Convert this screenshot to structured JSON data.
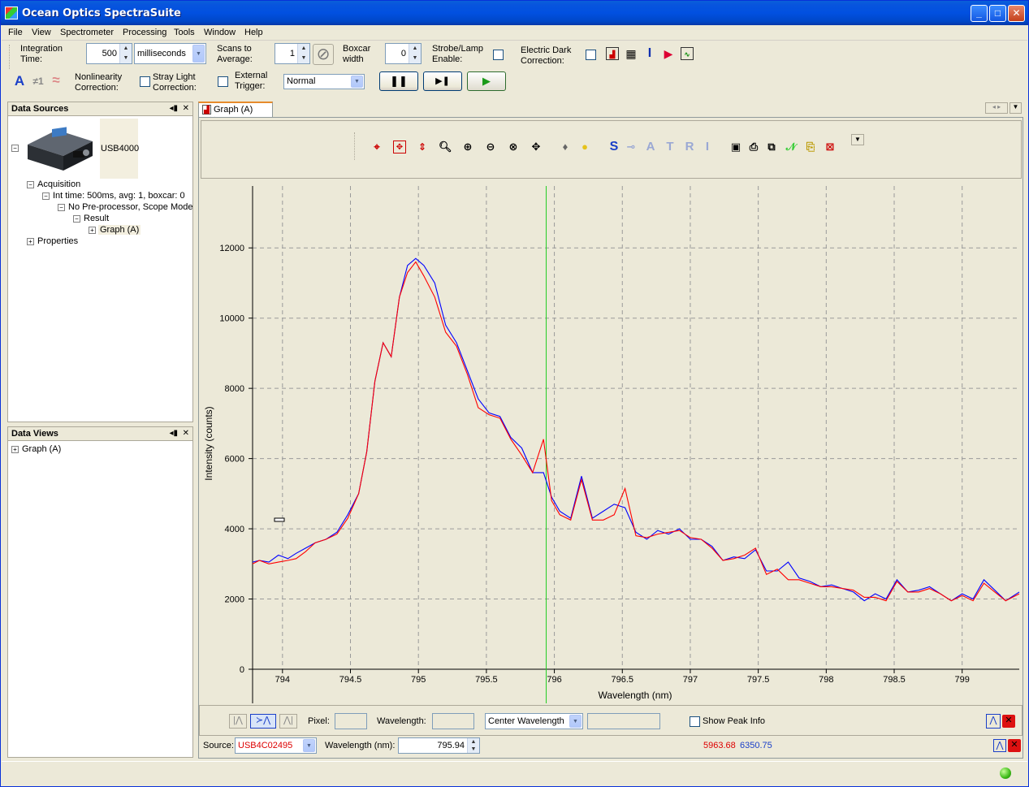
{
  "window": {
    "title": "Ocean Optics SpectraSuite",
    "minimize": "_",
    "maximize": "□",
    "close": "✕"
  },
  "menu": [
    "File",
    "View",
    "Spectrometer",
    "Processing",
    "Tools",
    "Window",
    "Help"
  ],
  "acq": {
    "integration_label": "Integration\nTime:",
    "integration_value": "500",
    "integration_unit": "milliseconds",
    "scans_label": "Scans to\nAverage:",
    "scans_value": "1",
    "boxcar_label": "Boxcar\nwidth",
    "boxcar_value": "0",
    "strobe_label": "Strobe/Lamp\nEnable:",
    "dark_label": "Electric Dark\nCorrection:",
    "nonlinearity_label": "Nonlinearity\nCorrection:",
    "stray_label": "Stray Light\nCorrection:",
    "trigger_label": "External\nTrigger:",
    "trigger_value": "Normal"
  },
  "data_sources": {
    "title": "Data Sources",
    "device": "USB4000",
    "acquisition": "Acquisition",
    "int_time": "Int time: 500ms, avg: 1, boxcar: 0",
    "processor": "No Pre-processor, Scope Mode",
    "result": "Result",
    "graph": "Graph (A)",
    "properties": "Properties"
  },
  "data_views": {
    "title": "Data Views",
    "graph": "Graph (A)"
  },
  "graph_tab": {
    "label": "Graph (A)",
    "close": "✕"
  },
  "graph_toolbar_letters": [
    "S",
    "A",
    "T",
    "R",
    "I"
  ],
  "bottom": {
    "pixel_label": "Pixel:",
    "wavelength_label": "Wavelength:",
    "center_wavelength": "Center Wavelength",
    "show_peak_info": "Show Peak Info",
    "source_label": "Source:",
    "source_value": "USB4C02495",
    "wavelength_nm_label": "Wavelength (nm):",
    "wavelength_nm_value": "795.94",
    "value_red": "5963.68",
    "value_blue": "6350.75"
  },
  "chart_data": {
    "type": "line",
    "xlabel": "Wavelength (nm)",
    "ylabel": "Intensity (counts)",
    "xlim": [
      793.78,
      799.42
    ],
    "ylim": [
      0,
      13000
    ],
    "xticks": [
      "794",
      "794.5",
      "795",
      "795.5",
      "796",
      "796.5",
      "797",
      "797.5",
      "798",
      "798.5",
      "799"
    ],
    "yticks": [
      "0",
      "2000",
      "4000",
      "6000",
      "8000",
      "10000",
      "12000"
    ],
    "cursor_x": 795.94,
    "grid": true,
    "series": [
      {
        "color": "#0000ff",
        "x": [
          793.78,
          793.83,
          793.9,
          793.97,
          794.04,
          794.1,
          794.17,
          794.24,
          794.32,
          794.4,
          794.48,
          794.56,
          794.62,
          794.68,
          794.74,
          794.8,
          794.86,
          794.92,
          794.98,
          795.04,
          795.12,
          795.2,
          795.28,
          795.36,
          795.44,
          795.52,
          795.6,
          795.68,
          795.76,
          795.84,
          795.92,
          795.98,
          796.04,
          796.12,
          796.2,
          796.28,
          796.36,
          796.44,
          796.52,
          796.6,
          796.68,
          796.76,
          796.84,
          796.92,
          797.0,
          797.08,
          797.16,
          797.24,
          797.32,
          797.4,
          797.48,
          797.56,
          797.64,
          797.72,
          797.8,
          797.88,
          797.96,
          798.04,
          798.12,
          798.2,
          798.28,
          798.36,
          798.44,
          798.52,
          798.6,
          798.68,
          798.76,
          798.84,
          798.92,
          799.0,
          799.08,
          799.16,
          799.24,
          799.32,
          799.42
        ],
        "y": [
          3050,
          3100,
          3050,
          3250,
          3150,
          3300,
          3450,
          3600,
          3700,
          3900,
          4400,
          5000,
          6200,
          8200,
          9300,
          8900,
          10600,
          11500,
          11700,
          11500,
          11000,
          9800,
          9300,
          8500,
          7700,
          7300,
          7200,
          6600,
          6300,
          5600,
          5600,
          4900,
          4500,
          4300,
          5500,
          4300,
          4500,
          4700,
          4600,
          3900,
          3700,
          3950,
          3850,
          4000,
          3700,
          3700,
          3500,
          3100,
          3200,
          3150,
          3400,
          2800,
          2800,
          3050,
          2600,
          2500,
          2350,
          2400,
          2300,
          2200,
          1950,
          2150,
          2000,
          2550,
          2200,
          2250,
          2350,
          2150,
          1950,
          2150,
          2000,
          2550,
          2250,
          1950,
          2200
        ]
      },
      {
        "color": "#ff0000",
        "x": [
          793.78,
          793.83,
          793.9,
          793.97,
          794.04,
          794.1,
          794.17,
          794.24,
          794.32,
          794.4,
          794.48,
          794.56,
          794.62,
          794.68,
          794.74,
          794.8,
          794.86,
          794.92,
          794.98,
          795.04,
          795.12,
          795.2,
          795.28,
          795.36,
          795.44,
          795.52,
          795.6,
          795.68,
          795.76,
          795.84,
          795.92,
          795.98,
          796.04,
          796.12,
          796.2,
          796.28,
          796.36,
          796.44,
          796.52,
          796.6,
          796.68,
          796.76,
          796.84,
          796.92,
          797.0,
          797.08,
          797.16,
          797.24,
          797.32,
          797.4,
          797.48,
          797.56,
          797.64,
          797.72,
          797.8,
          797.88,
          797.96,
          798.04,
          798.12,
          798.2,
          798.28,
          798.36,
          798.44,
          798.52,
          798.6,
          798.68,
          798.76,
          798.84,
          798.92,
          799.0,
          799.08,
          799.16,
          799.24,
          799.32,
          799.42
        ],
        "y": [
          3000,
          3100,
          3000,
          3050,
          3100,
          3150,
          3350,
          3600,
          3700,
          3850,
          4300,
          5000,
          6200,
          8200,
          9300,
          8900,
          10600,
          11300,
          11600,
          11200,
          10600,
          9600,
          9200,
          8400,
          7450,
          7250,
          7150,
          6550,
          6100,
          5600,
          6550,
          4800,
          4400,
          4250,
          5400,
          4250,
          4250,
          4400,
          5150,
          3800,
          3750,
          3850,
          3900,
          3950,
          3750,
          3700,
          3450,
          3100,
          3150,
          3250,
          3450,
          2700,
          2850,
          2550,
          2550,
          2450,
          2350,
          2350,
          2300,
          2250,
          2050,
          2050,
          1950,
          2500,
          2200,
          2200,
          2300,
          2150,
          1950,
          2100,
          1950,
          2450,
          2200,
          1950,
          2150
        ]
      }
    ]
  }
}
